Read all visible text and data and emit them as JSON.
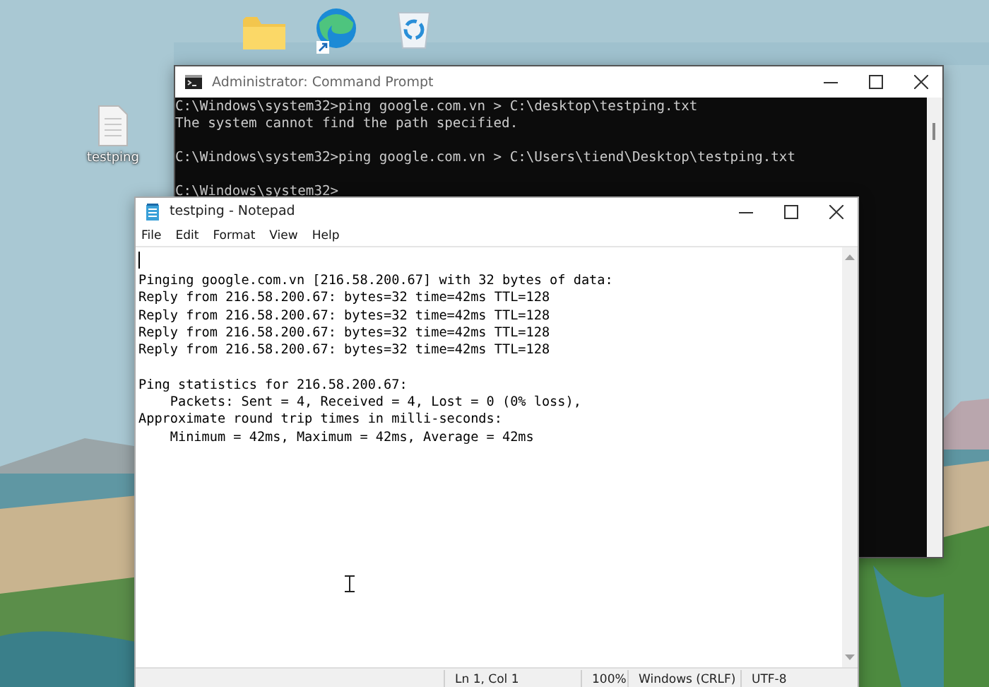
{
  "desktop_icons": [
    {
      "label": "testping"
    }
  ],
  "cmd": {
    "title": "Administrator: Command Prompt",
    "blocks": [
      [
        "C:\\Windows\\system32>ping google.com.vn > C:\\desktop\\testping.txt",
        "The system cannot find the path specified."
      ],
      [
        "C:\\Windows\\system32>ping google.com.vn > C:\\Users\\tiend\\Desktop\\testping.txt"
      ],
      [
        "C:\\Windows\\system32>"
      ]
    ]
  },
  "notepad": {
    "title": "testping - Notepad",
    "menu": [
      "File",
      "Edit",
      "Format",
      "View",
      "Help"
    ],
    "blocks": [
      [
        "Pinging google.com.vn [216.58.200.67] with 32 bytes of data:",
        "Reply from 216.58.200.67: bytes=32 time=42ms TTL=128",
        "Reply from 216.58.200.67: bytes=32 time=42ms TTL=128",
        "Reply from 216.58.200.67: bytes=32 time=42ms TTL=128",
        "Reply from 216.58.200.67: bytes=32 time=42ms TTL=128"
      ],
      [
        "Ping statistics for 216.58.200.67:",
        "    Packets: Sent = 4, Received = 4, Lost = 0 (0% loss),",
        "Approximate round trip times in milli-seconds:",
        "    Minimum = 42ms, Maximum = 42ms, Average = 42ms"
      ]
    ],
    "status_bar": {
      "position": "Ln 1, Col 1",
      "zoom": "100%",
      "line_ending": "Windows (CRLF)",
      "encoding": "UTF-8"
    }
  }
}
